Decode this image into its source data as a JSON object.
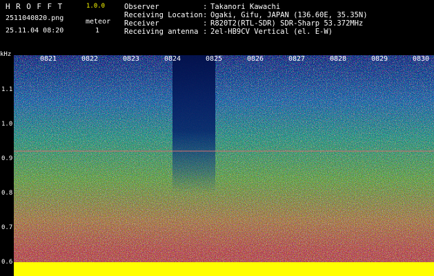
{
  "header": {
    "app_name": "HROFFT",
    "version": "1.0.0",
    "filename": "2511040820.png",
    "datetime": "25.11.04 08:20",
    "meteor_label": "meteor",
    "meteor_count": "1"
  },
  "info": [
    {
      "key": "Observer",
      "value": "Takanori Kawachi"
    },
    {
      "key": "Receiving Location",
      "value": "Ogaki, Gifu, JAPAN (136.60E, 35.35N)"
    },
    {
      "key": "Receiver",
      "value": "R820T2(RTL-SDR) SDR-Sharp 53.372MHz"
    },
    {
      "key": "Receiving antenna",
      "value": "2el-HB9CV Vertical (el. E-W)"
    }
  ],
  "axes": {
    "y_unit": "kHz",
    "y_ticks": [
      "1.1",
      "1.0",
      "0.9",
      "0.8",
      "0.7",
      "0.6"
    ],
    "x_ticks": [
      "0821",
      "0822",
      "0823",
      "0824",
      "0825",
      "0826",
      "0827",
      "0828",
      "0829",
      "0830"
    ]
  },
  "colors": {
    "background": "#000000",
    "header_text": "#ffffff",
    "version_text": "#ffff00",
    "baseline": "#ffff00",
    "spectrogram_low": "#0a2a8a",
    "spectrogram_high": "#ff2a2a"
  }
}
